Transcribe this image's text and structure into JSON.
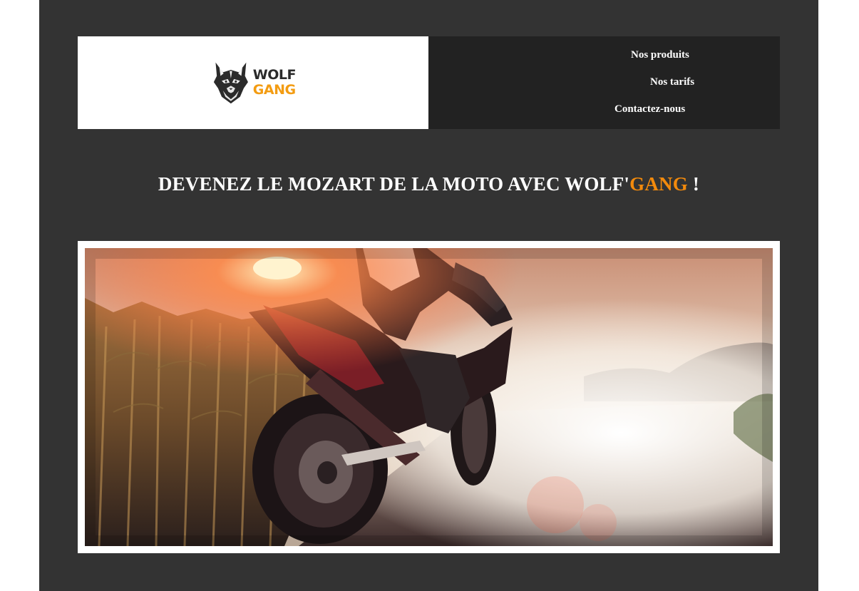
{
  "brand": {
    "logo_line1": "WOLF",
    "logo_line2": "GANG",
    "logo_icon": "wolf-head-icon",
    "accent_color": "#f39c12"
  },
  "nav": {
    "items": [
      {
        "label": "Nos produits"
      },
      {
        "label": "Nos tarifs"
      },
      {
        "label": "Contactez-nous"
      }
    ]
  },
  "hero": {
    "headline_main": "DEVENEZ LE MOZART DE LA MOTO AVEC WOLF'",
    "headline_accent": "GANG",
    "headline_end": " !",
    "image": "motorcycle-rider-at-night-photo"
  },
  "colors": {
    "page_bg": "#333333",
    "nav_bg": "#222222",
    "headline_accent": "#f38a0c"
  }
}
